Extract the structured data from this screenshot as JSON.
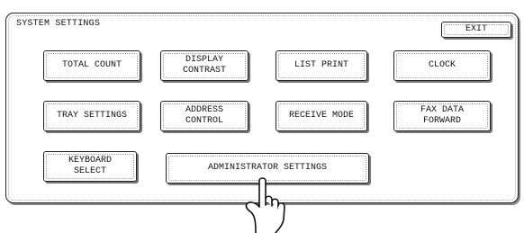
{
  "window": {
    "title": "SYSTEM SETTINGS"
  },
  "toolbar": {
    "exit_label": "EXIT"
  },
  "buttons": {
    "total_count": "TOTAL COUNT",
    "display_contrast": "DISPLAY\nCONTRAST",
    "list_print": "LIST PRINT",
    "clock": "CLOCK",
    "tray_settings": "TRAY SETTINGS",
    "address_control": "ADDRESS\nCONTROL",
    "receive_mode": "RECEIVE MODE",
    "fax_data_forward": "FAX DATA\nFORWARD",
    "keyboard_select": "KEYBOARD\nSELECT",
    "administrator_settings": "ADMINISTRATOR SETTINGS"
  },
  "icons": {
    "pointer": "pointing-hand-icon"
  },
  "colors": {
    "border": "#222222",
    "shadow": "#777777",
    "background": "#ffffff"
  }
}
